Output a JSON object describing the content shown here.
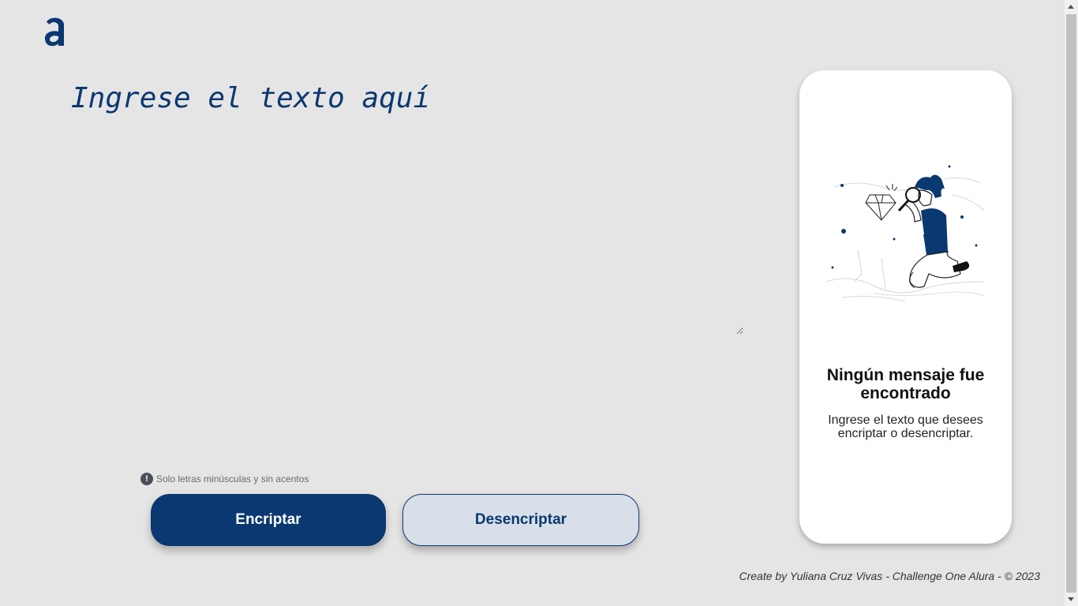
{
  "brand": {
    "logo_icon": "alura-a-logo",
    "accent_color": "#0a3871"
  },
  "input": {
    "placeholder": "Ingrese el texto aquí",
    "value": ""
  },
  "hint": {
    "icon": "exclamation-circle-icon",
    "text": "Solo letras minúsculas y sin acentos"
  },
  "actions": {
    "encrypt_label": "Encriptar",
    "decrypt_label": "Desencriptar"
  },
  "output_panel": {
    "illustration": "person-with-magnifying-glass-illustration",
    "title": "Ningún mensaje fue encontrado",
    "message": "Ingrese el texto que desees encriptar o desencriptar."
  },
  "footer": {
    "text": "Create by Yuliana Cruz Vivas - Challenge One Alura - © 2023"
  }
}
